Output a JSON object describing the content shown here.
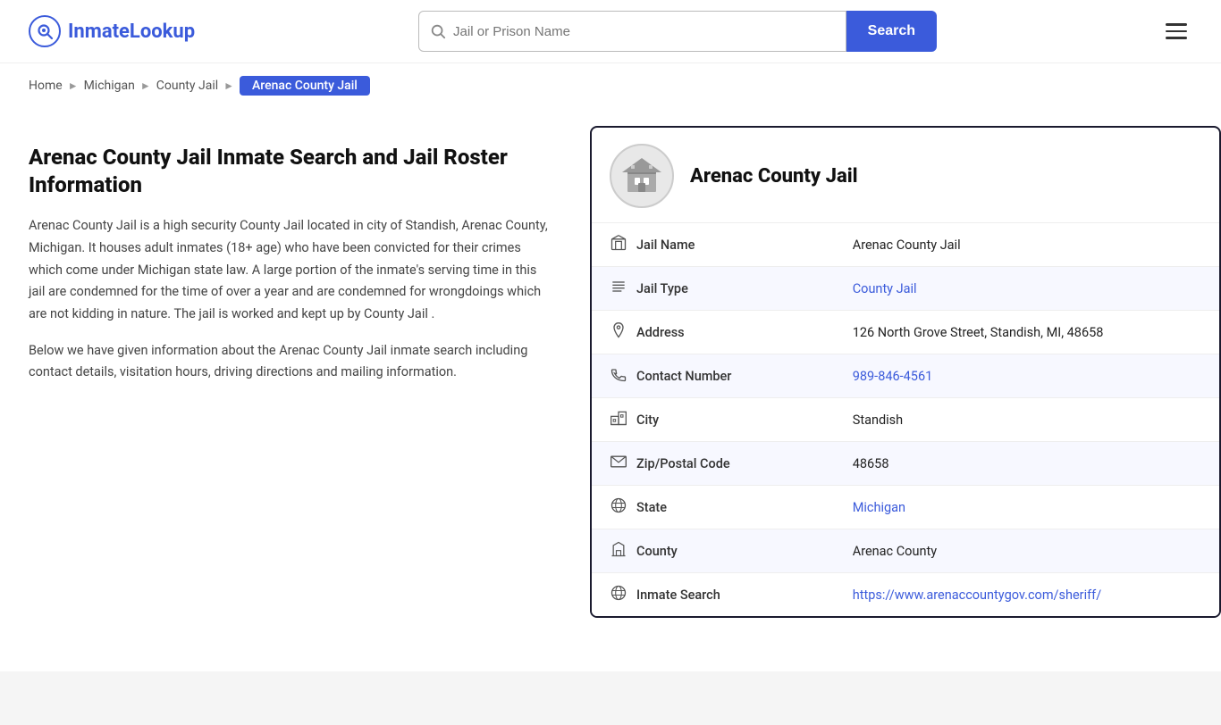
{
  "header": {
    "logo_name": "InmateLookup",
    "logo_highlight": "Inmate",
    "search_placeholder": "Jail or Prison Name",
    "search_button_label": "Search",
    "menu_icon": "hamburger-icon"
  },
  "breadcrumb": {
    "items": [
      {
        "label": "Home",
        "href": "#",
        "active": false
      },
      {
        "label": "Michigan",
        "href": "#",
        "active": false
      },
      {
        "label": "County Jail",
        "href": "#",
        "active": false
      },
      {
        "label": "Arenac County Jail",
        "href": "#",
        "active": true
      }
    ]
  },
  "left": {
    "heading": "Arenac County Jail Inmate Search and Jail Roster Information",
    "para1": "Arenac County Jail is a high security County Jail located in city of Standish, Arenac County, Michigan. It houses adult inmates (18+ age) who have been convicted for their crimes which come under Michigan state law. A large portion of the inmate's serving time in this jail are condemned for the time of over a year and are condemned for wrongdoings which are not kidding in nature. The jail is worked and kept up by County Jail .",
    "para2": "Below we have given information about the Arenac County Jail inmate search including contact details, visitation hours, driving directions and mailing information."
  },
  "card": {
    "title": "Arenac County Jail",
    "rows": [
      {
        "id": "jail-name",
        "icon": "building-icon",
        "label": "Jail Name",
        "value": "Arenac County Jail",
        "link": null
      },
      {
        "id": "jail-type",
        "icon": "list-icon",
        "label": "Jail Type",
        "value": "County Jail",
        "link": "#"
      },
      {
        "id": "address",
        "icon": "pin-icon",
        "label": "Address",
        "value": "126 North Grove Street, Standish, MI, 48658",
        "link": null
      },
      {
        "id": "contact-number",
        "icon": "phone-icon",
        "label": "Contact Number",
        "value": "989-846-4561",
        "link": "tel:9898464561"
      },
      {
        "id": "city",
        "icon": "city-icon",
        "label": "City",
        "value": "Standish",
        "link": null
      },
      {
        "id": "zip",
        "icon": "mail-icon",
        "label": "Zip/Postal Code",
        "value": "48658",
        "link": null
      },
      {
        "id": "state",
        "icon": "globe-icon",
        "label": "State",
        "value": "Michigan",
        "link": "#"
      },
      {
        "id": "county",
        "icon": "county-icon",
        "label": "County",
        "value": "Arenac County",
        "link": null
      },
      {
        "id": "inmate-search",
        "icon": "search-globe-icon",
        "label": "Inmate Search",
        "value": "https://www.arenaccountygov.com/sheriff/",
        "link": "https://www.arenaccountygov.com/sheriff/"
      }
    ]
  }
}
